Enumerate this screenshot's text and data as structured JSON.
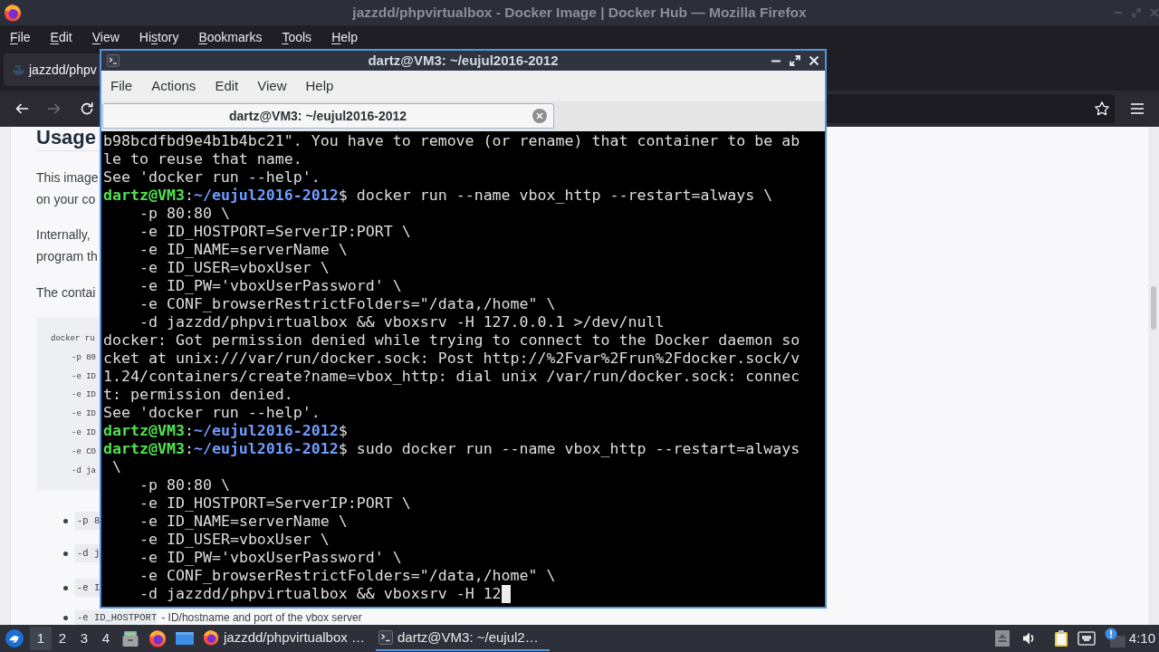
{
  "firefox": {
    "title": "jazzdd/phpvirtualbox - Docker Image | Docker Hub — Mozilla Firefox",
    "menu": [
      {
        "key": "F",
        "after": "ile"
      },
      {
        "key": "E",
        "after": "dit"
      },
      {
        "key": "V",
        "after": "iew"
      },
      {
        "before": "Hi",
        "key": "s",
        "after": "tory"
      },
      {
        "key": "B",
        "after": "ookmarks"
      },
      {
        "key": "T",
        "after": "ools"
      },
      {
        "key": "H",
        "after": "elp"
      }
    ],
    "tabs": [
      {
        "label": "jazzdd/phpv",
        "selected": true
      }
    ],
    "nav_buttons": [
      {
        "kind": "back",
        "disabled": false
      },
      {
        "kind": "forward",
        "disabled": true
      },
      {
        "kind": "reload",
        "disabled": false
      }
    ],
    "page": {
      "heading": "Usage",
      "paragraphs": [
        [
          "This image",
          "on your co"
        ],
        [
          "Internally,",
          "program th"
        ],
        [
          "The contai"
        ]
      ],
      "code_block": {
        "command": "docker ru",
        "options": [
          "-p 80",
          "-e ID",
          "-e ID",
          "-e ID",
          "-e ID",
          "-e CO",
          "-d ja"
        ]
      },
      "bullets": [
        {
          "code": "-p 8"
        },
        {
          "code": "-d j"
        },
        {
          "code": "-e I"
        },
        {
          "code": "-e ID_HOSTPORT",
          "text": "- ID/hostname and port of the vbox server"
        }
      ]
    }
  },
  "terminal": {
    "title": "dartz@VM3: ~/eujul2016-2012",
    "menu": [
      "File",
      "Actions",
      "Edit",
      "View",
      "Help"
    ],
    "tabs": [
      {
        "label": "dartz@VM3: ~/eujul2016-2012",
        "selected": true
      }
    ],
    "lines": [
      {
        "kind": "output",
        "text": "b98bcdfbd9e4b1b4bc21\". You have to remove (or rename) that container to be ab"
      },
      {
        "kind": "output",
        "text": "le to reuse that name."
      },
      {
        "kind": "output",
        "text": "See 'docker run --help'."
      },
      {
        "kind": "prompt",
        "user": "dartz@VM3",
        "separator": ":",
        "path": "~/eujul2016-2012",
        "command": "$ docker run --name vbox_http --restart=always \\"
      },
      {
        "kind": "continued",
        "text": "-p 80:80 \\"
      },
      {
        "kind": "continued",
        "text": "-e ID_HOSTPORT=ServerIP:PORT \\"
      },
      {
        "kind": "continued",
        "text": "-e ID_NAME=serverName \\"
      },
      {
        "kind": "continued",
        "text": "-e ID_USER=vboxUser \\"
      },
      {
        "kind": "continued",
        "text": "-e ID_PW='vboxUserPassword' \\"
      },
      {
        "kind": "continued",
        "text": "-e CONF_browserRestrictFolders=\"/data,/home\" \\"
      },
      {
        "kind": "continued",
        "text": "-d jazzdd/phpvirtualbox && vboxsrv -H 127.0.0.1 >/dev/null"
      },
      {
        "kind": "output",
        "text": "docker: Got permission denied while trying to connect to the Docker daemon so"
      },
      {
        "kind": "output",
        "text": "cket at unix:///var/run/docker.sock: Post http://%2Fvar%2Frun%2Fdocker.sock/v"
      },
      {
        "kind": "output",
        "text": "1.24/containers/create?name=vbox_http: dial unix /var/run/docker.sock: connec"
      },
      {
        "kind": "output",
        "text": "t: permission denied."
      },
      {
        "kind": "output",
        "text": "See 'docker run --help'."
      },
      {
        "kind": "prompt",
        "user": "dartz@VM3",
        "separator": ":",
        "path": "~/eujul2016-2012",
        "command": "$"
      },
      {
        "kind": "prompt",
        "user": "dartz@VM3",
        "separator": ":",
        "path": "~/eujul2016-2012",
        "command": "$ sudo docker run --name vbox_http --restart=always"
      },
      {
        "kind": "wrapped",
        "text": "\\"
      },
      {
        "kind": "continued",
        "text": "-p 80:80 \\"
      },
      {
        "kind": "continued",
        "text": "-e ID_HOSTPORT=ServerIP:PORT \\"
      },
      {
        "kind": "continued",
        "text": "-e ID_NAME=serverName \\"
      },
      {
        "kind": "continued",
        "text": "-e ID_USER=vboxUser \\"
      },
      {
        "kind": "continued",
        "text": "-e ID_PW='vboxUserPassword' \\"
      },
      {
        "kind": "continued",
        "text": "-e CONF_browserRestrictFolders=\"/data,/home\" \\"
      },
      {
        "kind": "continued",
        "text": "-d jazzdd/phpvirtualbox && vboxsrv -H 12"
      }
    ],
    "cursor": true
  },
  "taskbar": {
    "workspaces": [
      {
        "label": "1",
        "selected": true
      },
      {
        "label": "2",
        "selected": false
      },
      {
        "label": "3",
        "selected": false
      },
      {
        "label": "4",
        "selected": false
      }
    ],
    "tasks": [
      {
        "kind": "browser",
        "label": "jazzdd/phpvirtualbox …",
        "selected": false
      },
      {
        "kind": "terminal",
        "label": "dartz@VM3: ~/eujul2…",
        "selected": true
      }
    ],
    "clock": "4:10"
  }
}
